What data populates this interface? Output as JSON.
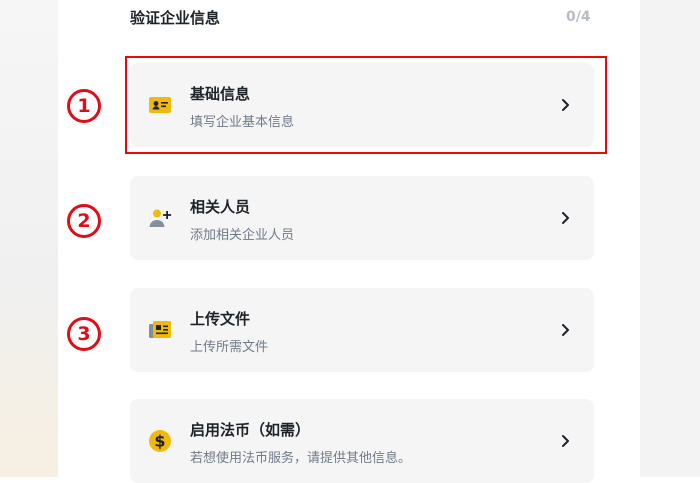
{
  "header": {
    "title": "验证企业信息",
    "progress": "0/4"
  },
  "steps": [
    "1",
    "2",
    "3"
  ],
  "cards": [
    {
      "name": "基础信息",
      "desc": "填写企业基本信息",
      "icon": "id-card-icon"
    },
    {
      "name": "相关人员",
      "desc": "添加相关企业人员",
      "icon": "add-person-icon"
    },
    {
      "name": "上传文件",
      "desc": "上传所需文件",
      "icon": "document-icon"
    },
    {
      "name": "启用法币（如需）",
      "desc": "若想使用法币服务，请提供其他信息。",
      "icon": "dollar-coin-icon"
    }
  ],
  "colors": {
    "accent": "#f0b90b",
    "highlight": "#e50914",
    "card_bg": "#f5f5f5",
    "text_primary": "#1e2329",
    "text_secondary": "#707a8a"
  }
}
